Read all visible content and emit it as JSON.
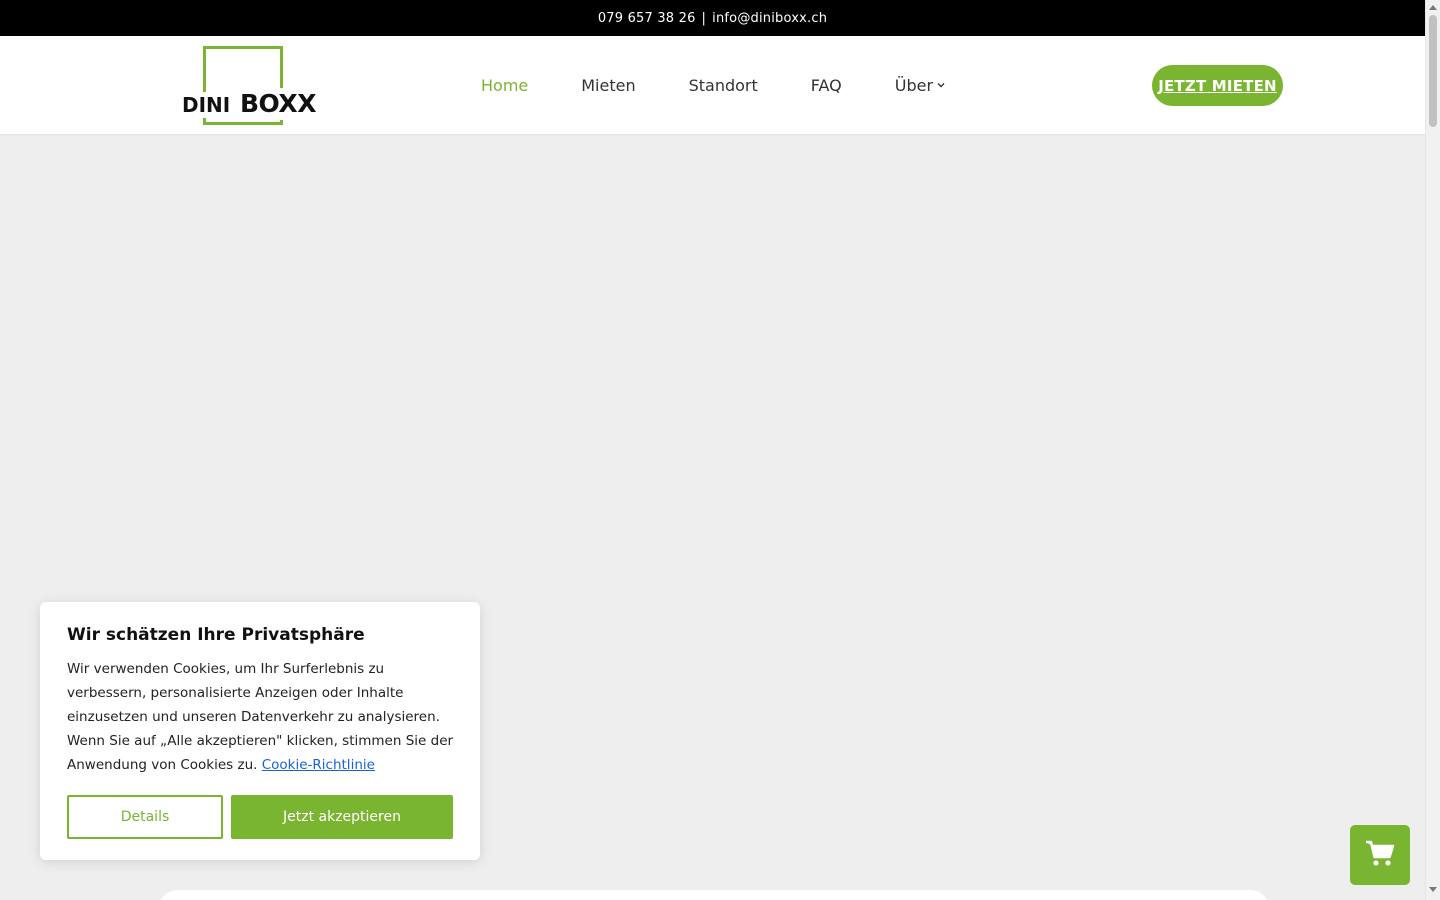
{
  "topbar": {
    "phone": "079 657 38 26",
    "separator": "|",
    "email": "info@diniboxx.ch"
  },
  "logo": {
    "word1": "DINI",
    "word2": "BOXX"
  },
  "nav": {
    "items": [
      {
        "label": "Home",
        "active": true
      },
      {
        "label": "Mieten"
      },
      {
        "label": "Standort"
      },
      {
        "label": "FAQ"
      },
      {
        "label": "Über",
        "has_dropdown": true
      }
    ],
    "dropdown_icon": "chevron-down-icon"
  },
  "cta": {
    "label": "JETZT MIETEN"
  },
  "cookie": {
    "title": "Wir schätzen Ihre Privatsphäre",
    "text": "Wir verwenden Cookies, um Ihr Surferlebnis zu verbessern, personalisierte Anzeigen oder Inhalte einzusetzen und unseren Datenverkehr zu analysieren. Wenn Sie auf „Alle akzeptieren\" klicken, stimmen Sie der Anwendung von Cookies zu.",
    "link_label": "Cookie-Richtlinie",
    "details_label": "Details",
    "accept_label": "Jetzt akzeptieren"
  },
  "cart": {
    "icon": "shopping-cart-icon"
  },
  "colors": {
    "accent": "#7ab531",
    "topbar_bg": "#000000",
    "page_bg": "#eeeeee",
    "link": "#1863dc"
  }
}
